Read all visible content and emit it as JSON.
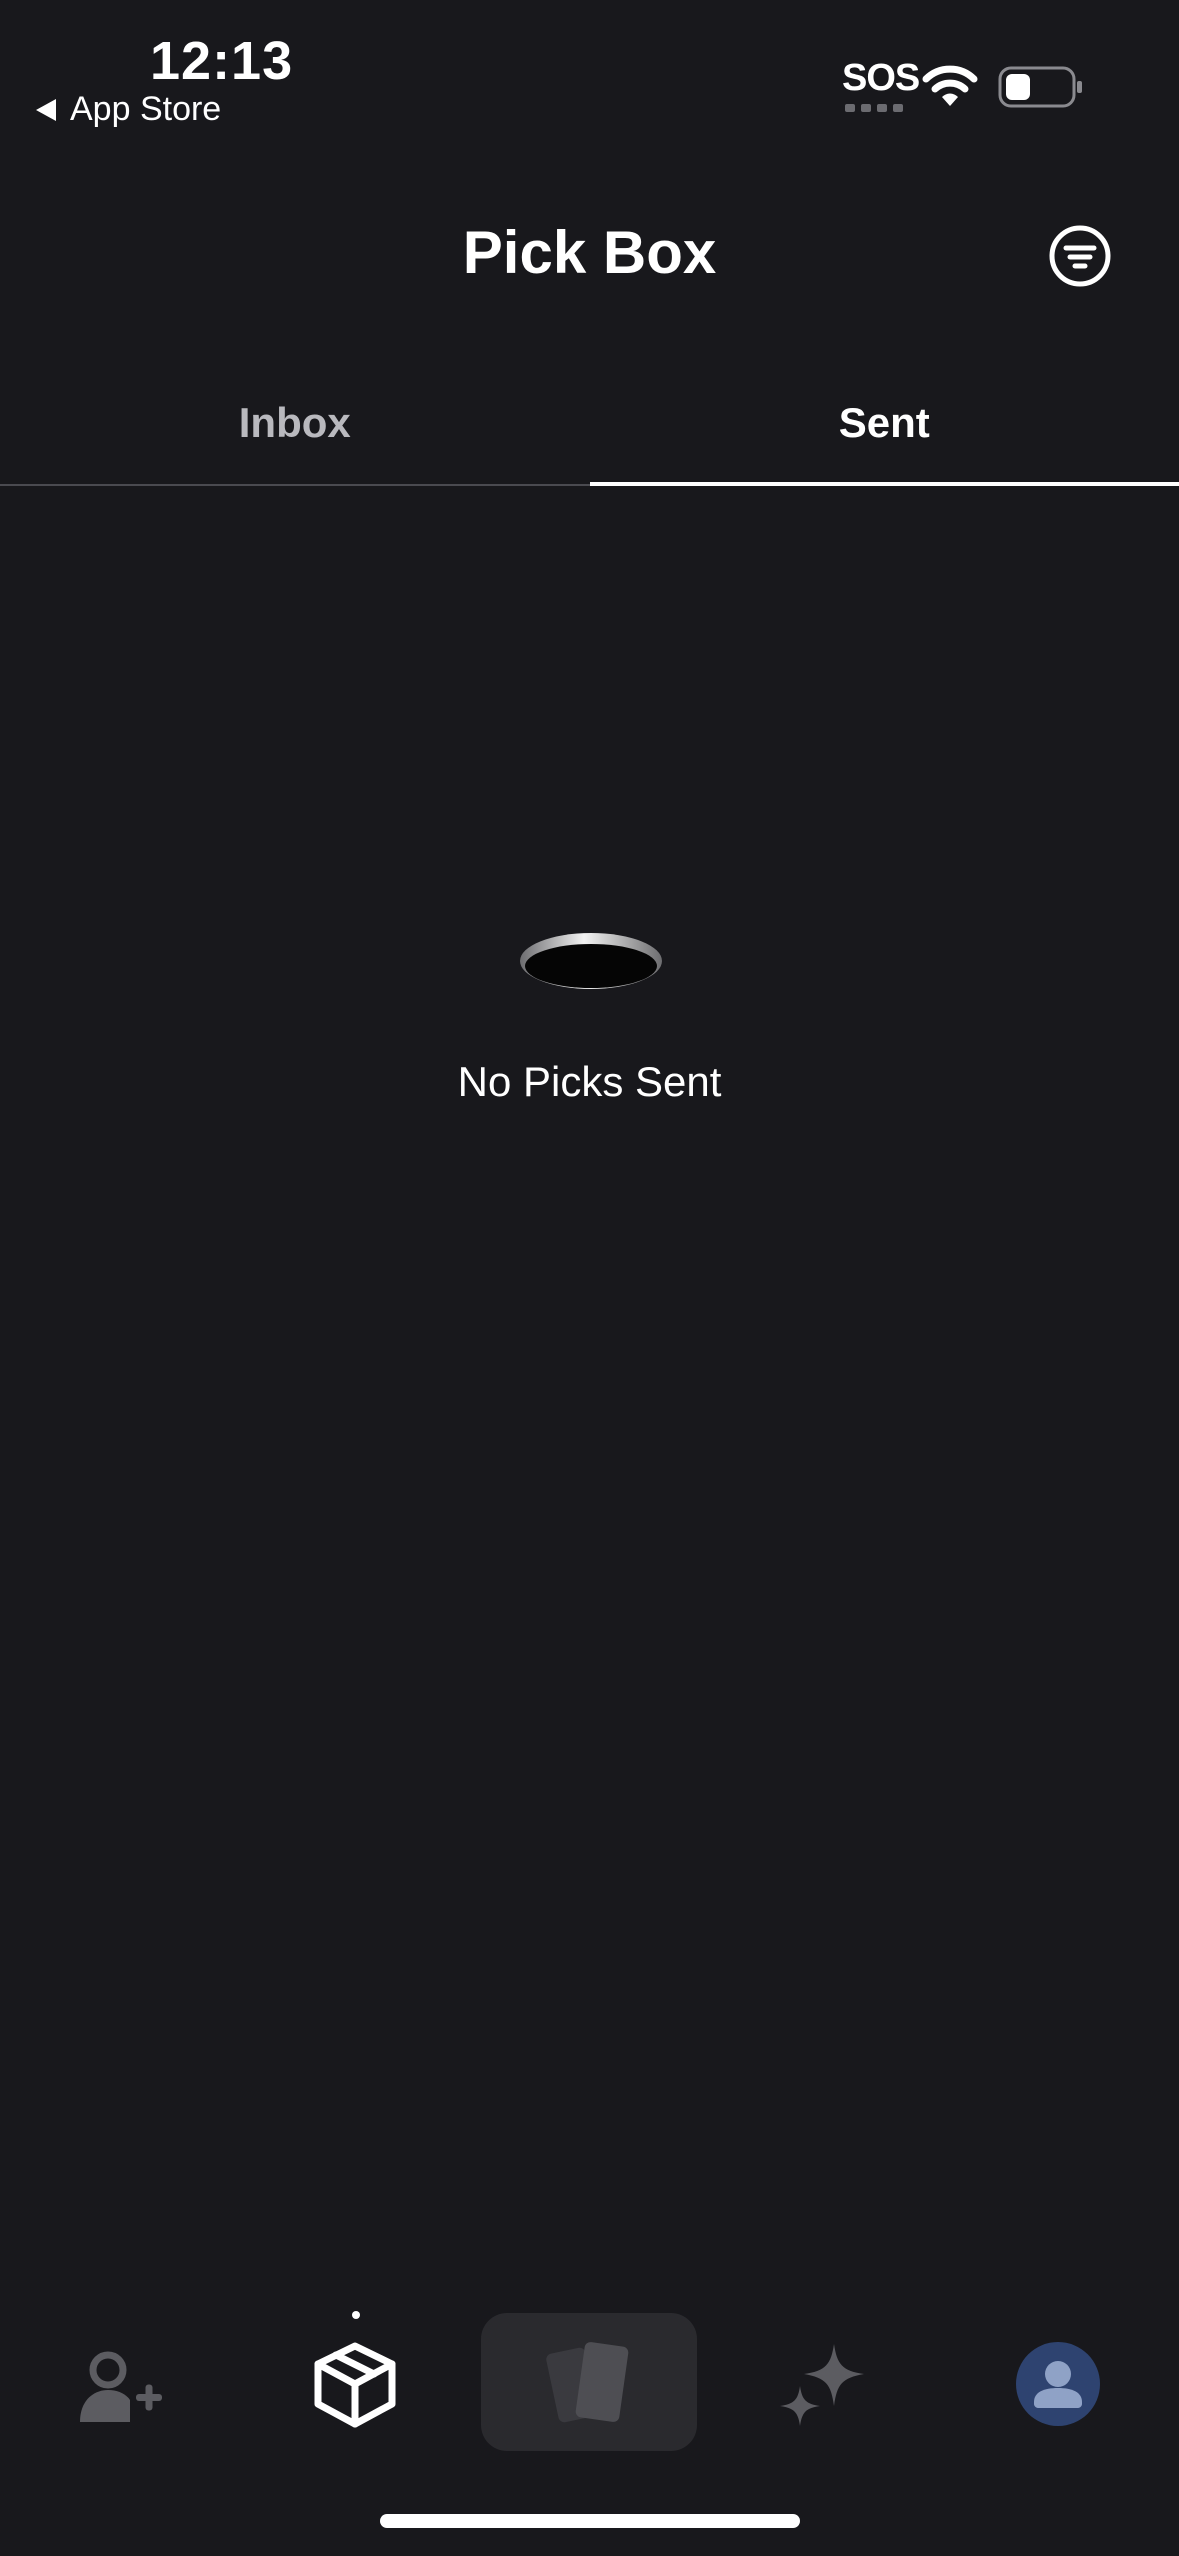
{
  "status_bar": {
    "time": "12:13",
    "back_label": "App Store",
    "sos_label": "SOS",
    "wifi_icon": "wifi-icon",
    "battery_icon": "battery-icon"
  },
  "header": {
    "title": "Pick Box",
    "filter_icon": "filter-icon"
  },
  "tabs": [
    {
      "label": "Inbox",
      "active": false
    },
    {
      "label": "Sent",
      "active": true
    }
  ],
  "empty_state": {
    "icon": "hole-icon",
    "message": "No Picks Sent"
  },
  "bottom_nav": {
    "items": [
      {
        "name": "add-friend",
        "icon": "add-friend-icon",
        "active": false
      },
      {
        "name": "pick-box",
        "icon": "box-icon",
        "active": true
      },
      {
        "name": "cards",
        "icon": "cards-icon",
        "active": false
      },
      {
        "name": "sparkle",
        "icon": "sparkle-icon",
        "active": false
      },
      {
        "name": "profile",
        "icon": "avatar-icon",
        "active": false
      }
    ]
  },
  "colors": {
    "background": "#18181c",
    "tab_inactive": "#b9b9be",
    "nav_inactive": "#5c5c61",
    "avatar_bg": "#2e4370",
    "avatar_fg": "#8fa2c6"
  }
}
